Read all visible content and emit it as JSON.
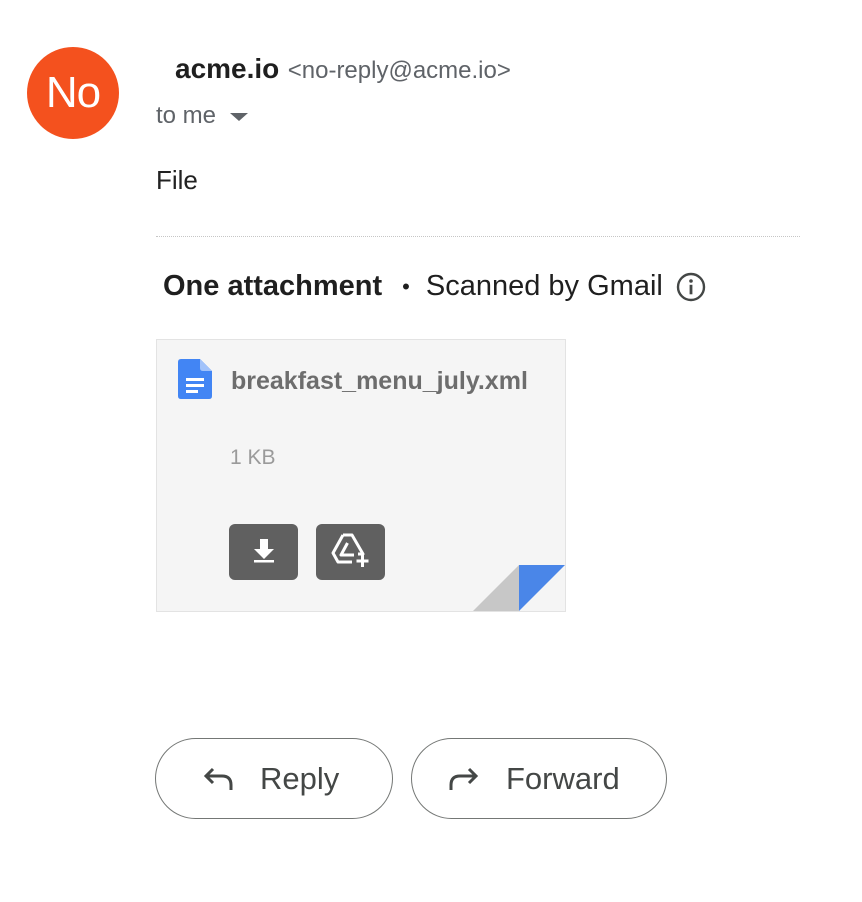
{
  "sender": {
    "avatar_initials": "No",
    "avatar_color": "#f4511e",
    "name": "acme.io",
    "email": "<no-reply@acme.io>"
  },
  "recipient": {
    "label": "to me"
  },
  "message": {
    "body": "File"
  },
  "attachments": {
    "count_label": "One attachment",
    "separator": "•",
    "scan_label": "Scanned by Gmail",
    "files": [
      {
        "name": "breakfast_menu_july.xml",
        "size": "1 KB",
        "icon": "google-docs-icon"
      }
    ]
  },
  "actions": {
    "reply_label": "Reply",
    "forward_label": "Forward"
  }
}
